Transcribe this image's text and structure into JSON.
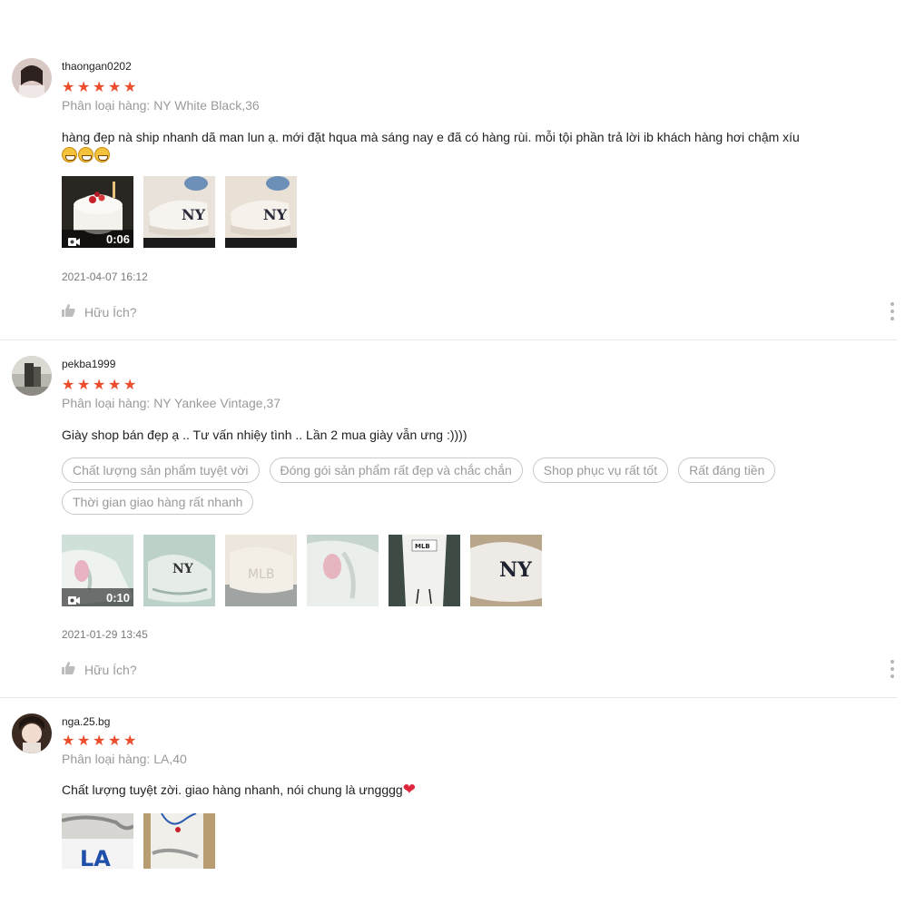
{
  "reviews": [
    {
      "username": "thaongan0202",
      "rating": 5,
      "variation": "Phân loại hàng: NY White Black,36",
      "comment": "hàng đẹp nà ship nhanh dã man lun ạ. mới đặt hqua mà sáng nay e đã có hàng rùi. mỗi tội phần trả lời ib khách hàng hơi chậm xíu",
      "emoji_count": 3,
      "video_duration": "0:06",
      "date": "2021-04-07 16:12",
      "helpful_label": "Hữu Ích?"
    },
    {
      "username": "pekba1999",
      "rating": 5,
      "variation": "Phân loại hàng: NY Yankee Vintage,37",
      "comment": "Giày shop bán đẹp ạ .. Tư vấn nhiệy tình .. Lần 2 mua giày vẫn ưng :))))",
      "tags": [
        "Chất lượng sản phẩm tuyệt vời",
        "Đóng gói sản phẩm rất đẹp và chắc chắn",
        "Shop phục vụ rất tốt",
        "Rất đáng tiền",
        "Thời gian giao hàng rất nhanh"
      ],
      "video_duration": "0:10",
      "date": "2021-01-29 13:45",
      "helpful_label": "Hữu Ích?"
    },
    {
      "username": "nga.25.bg",
      "rating": 5,
      "variation": "Phân loại hàng: LA,40",
      "comment": "Chất lượng tuyệt zời. giao hàng nhanh, nói chung là ưngggg"
    }
  ],
  "colors": {
    "star": "#ee4d2d",
    "muted": "#9a9a9a",
    "divider": "#e8e8e8"
  },
  "icons": [
    "star-icon",
    "thumbs-up-icon",
    "video-camera-icon",
    "more-options-icon",
    "heart-icon",
    "grin-emoji-icon"
  ]
}
